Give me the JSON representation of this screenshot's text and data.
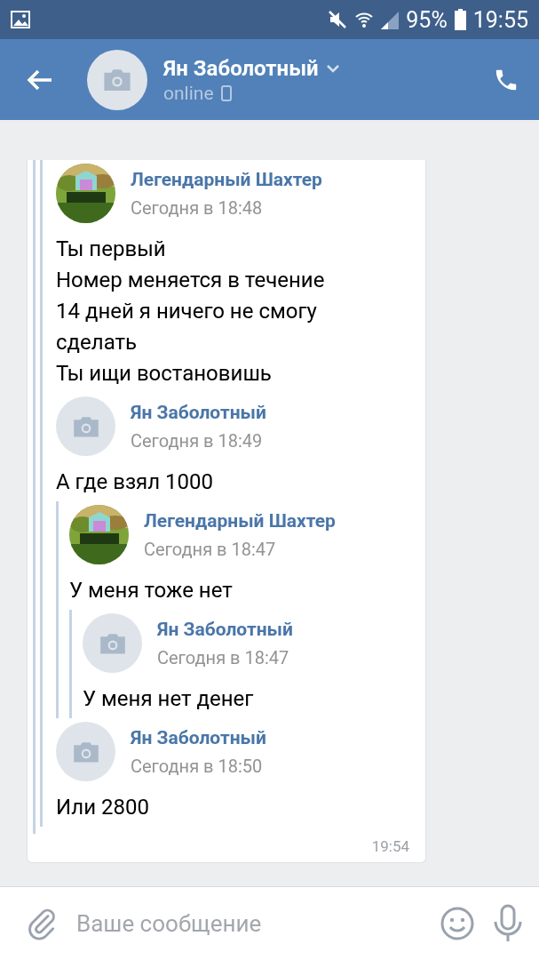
{
  "status_bar": {
    "battery": "95%",
    "time": "19:55"
  },
  "header": {
    "name": "Ян Заболотный",
    "status": "online"
  },
  "message": {
    "time": "19:54",
    "forwarded": [
      {
        "forwarded": [
          {
            "author": "Легендарный Шахтер",
            "time": "Сегодня в 18:48",
            "lines": [
              "Ты первый",
              "Номер меняется в течение",
              "14 дней я ничего не смогу",
              "сделать",
              "Ты ищи востановишь"
            ]
          },
          {
            "kind": "placeholder",
            "author": "Ян Заболотный",
            "time": "Сегодня в 18:49",
            "lines": [
              "А где взял 1000"
            ],
            "forwarded": [
              {
                "author": "Легендарный Шахтер",
                "time": "Сегодня в 18:47",
                "lines": [
                  "У меня тоже нет"
                ],
                "forwarded": [
                  {
                    "kind": "placeholder",
                    "author": "Ян Заболотный",
                    "time": "Сегодня в 18:47",
                    "lines": [
                      "У меня нет денег"
                    ]
                  }
                ]
              }
            ]
          },
          {
            "kind": "placeholder",
            "author": "Ян Заболотный",
            "time": "Сегодня в 18:50",
            "lines": [
              "Или 2800"
            ]
          }
        ]
      }
    ]
  },
  "composer": {
    "placeholder": "Ваше сообщение"
  }
}
